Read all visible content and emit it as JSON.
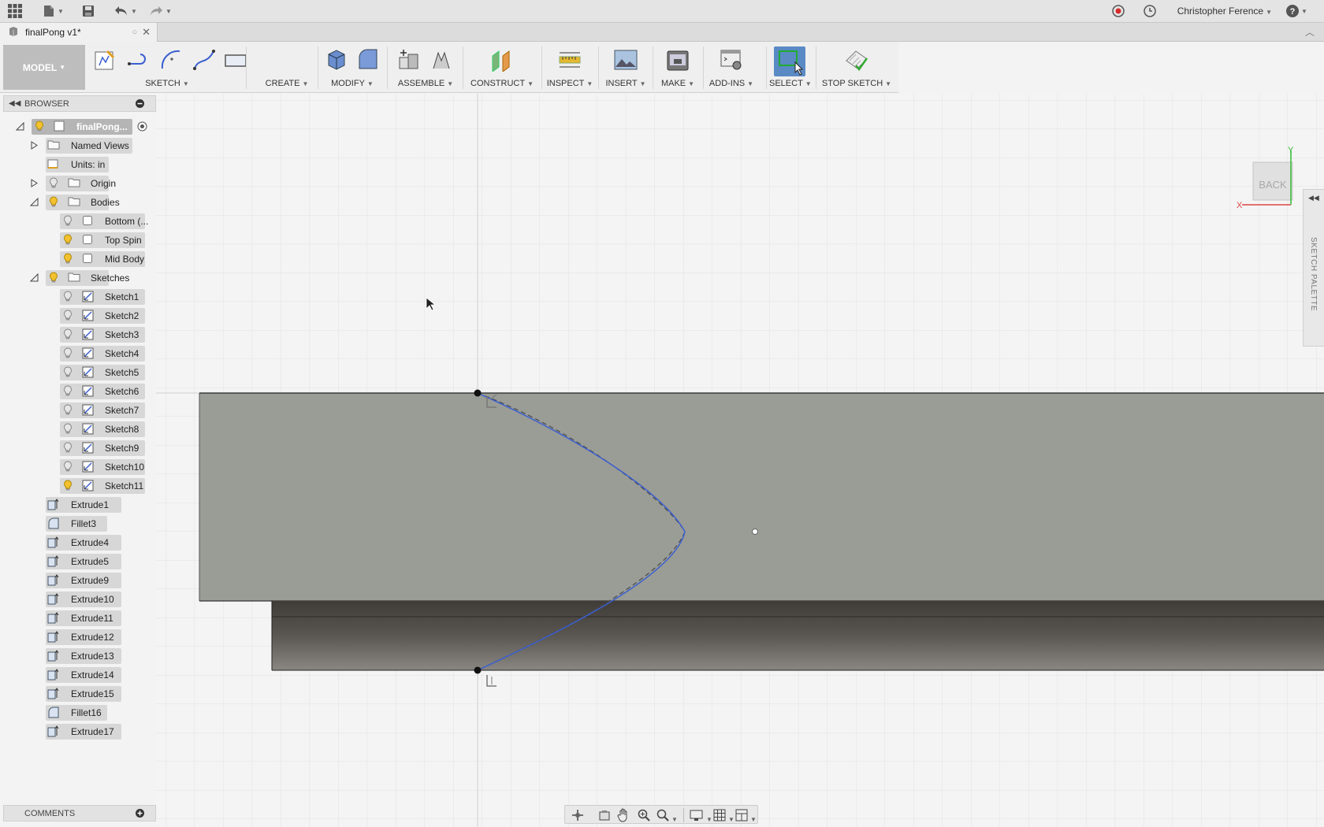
{
  "topbar": {
    "user_name": "Christopher Ference"
  },
  "document": {
    "tab_title": "finalPong v1*"
  },
  "toolbar": {
    "workspace": "MODEL",
    "groups": [
      {
        "label": "SKETCH"
      },
      {
        "label": "CREATE"
      },
      {
        "label": "MODIFY"
      },
      {
        "label": "ASSEMBLE"
      },
      {
        "label": "CONSTRUCT"
      },
      {
        "label": "INSPECT"
      },
      {
        "label": "INSERT"
      },
      {
        "label": "MAKE"
      },
      {
        "label": "ADD-INS"
      },
      {
        "label": "SELECT"
      },
      {
        "label": "STOP SKETCH"
      }
    ]
  },
  "browser": {
    "title": "BROWSER",
    "root": "finalPong...",
    "named_views": "Named Views",
    "units": "Units: in",
    "origin": "Origin",
    "bodies": "Bodies",
    "body_items": [
      "Bottom (...",
      "Top Spin",
      "Mid Body"
    ],
    "sketches": "Sketches",
    "sketch_items": [
      "Sketch1",
      "Sketch2",
      "Sketch3",
      "Sketch4",
      "Sketch5",
      "Sketch6",
      "Sketch7",
      "Sketch8",
      "Sketch9",
      "Sketch10",
      "Sketch11"
    ],
    "features": [
      "Extrude1",
      "Fillet3",
      "Extrude4",
      "Extrude5",
      "Extrude9",
      "Extrude10",
      "Extrude11",
      "Extrude12",
      "Extrude13",
      "Extrude14",
      "Extrude15",
      "Fillet16",
      "Extrude17"
    ]
  },
  "comments": {
    "title": "COMMENTS"
  },
  "viewcube": {
    "face": "BACK",
    "axis_x": "X",
    "axis_y": "Y"
  },
  "sketch_palette": {
    "label": "SKETCH PALETTE"
  },
  "colors": {
    "accent_blue": "#3a5fd0",
    "select_blue": "#5a8ac4",
    "body_gray": "#9a9c96"
  }
}
